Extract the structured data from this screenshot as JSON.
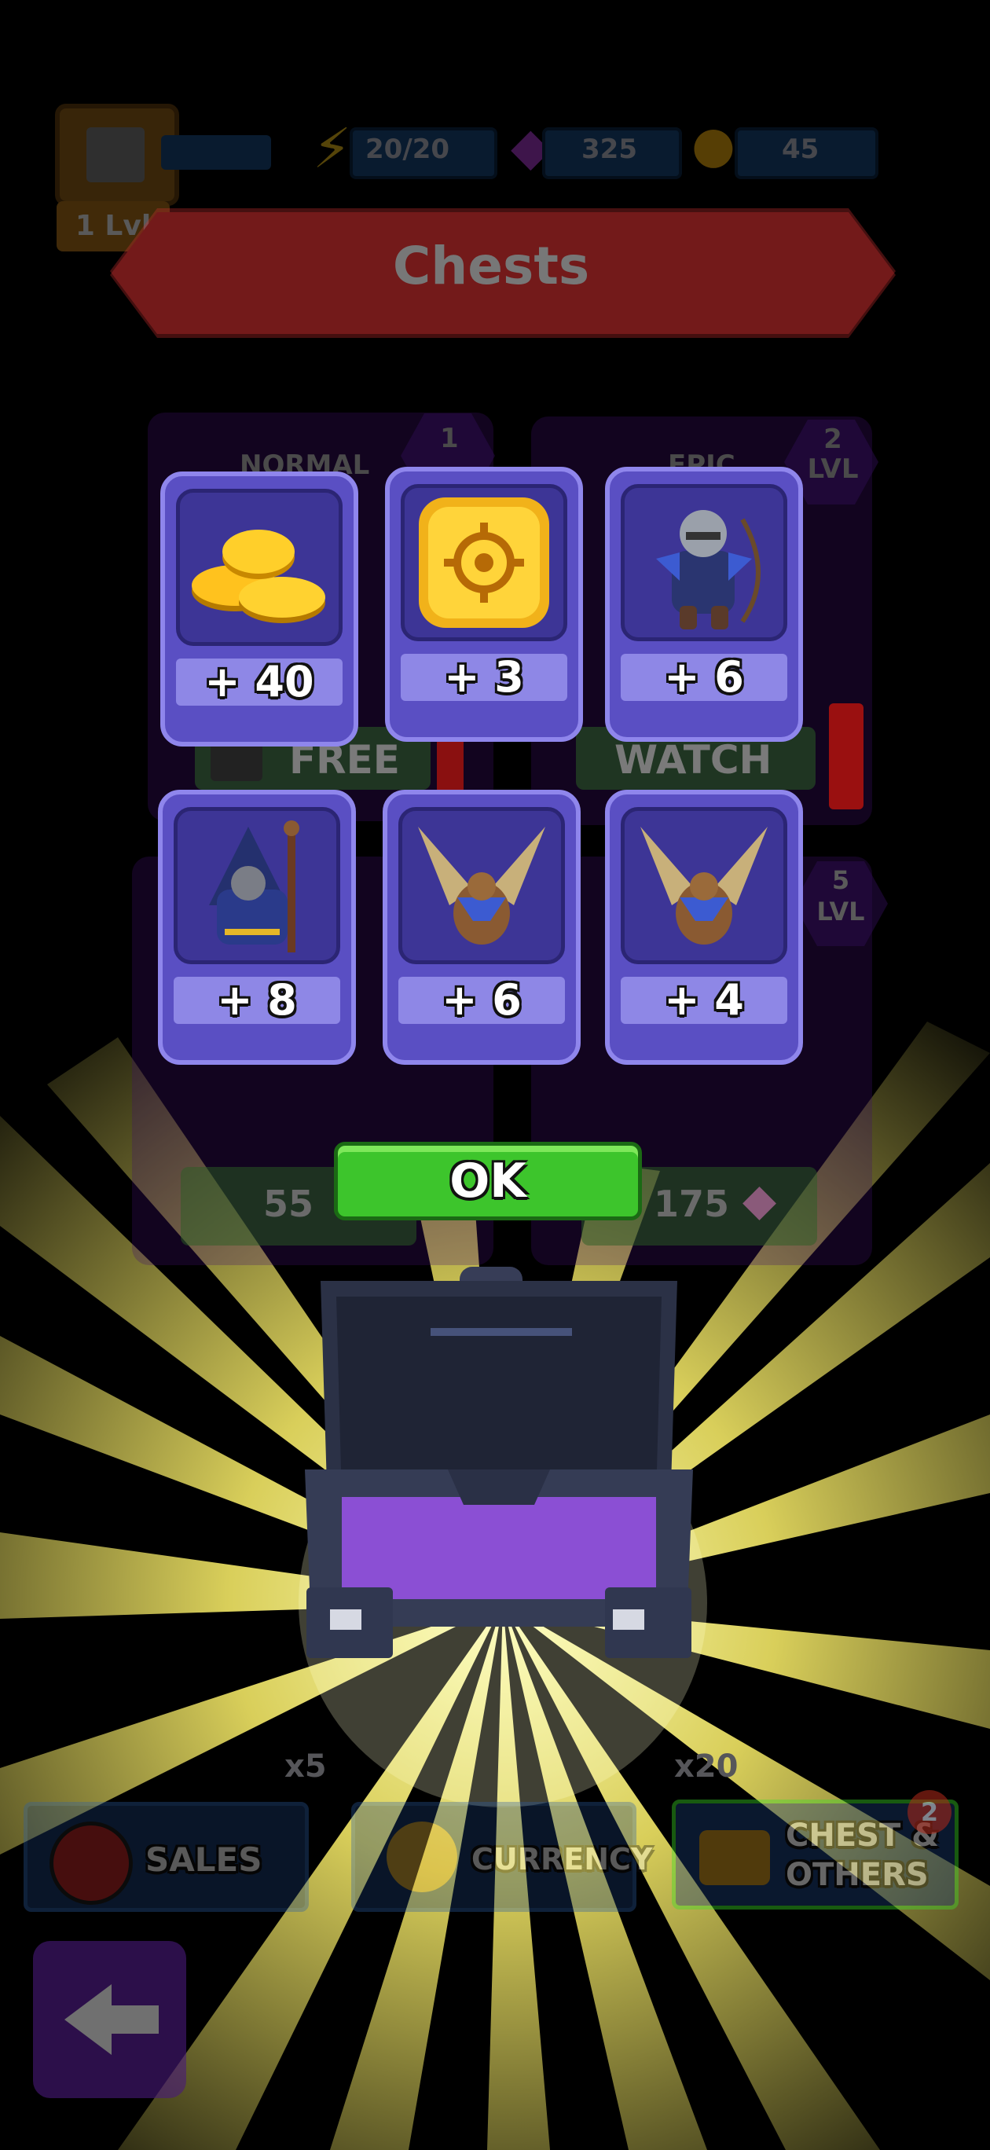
{
  "colors": {
    "accent": "#4fd13a",
    "tile": "#5a4fc3",
    "burst": "#fff36a",
    "panel": "#3f0f6e"
  },
  "header": {
    "level": "1 Lvl",
    "energy": "20/20",
    "gems": "325",
    "coins": "45",
    "title": "Chests"
  },
  "background": {
    "normal_label": "NORMAL",
    "normal_level": "1",
    "epic_label": "EPIC",
    "epic_level": "2 LVL",
    "free_button": "FREE",
    "watch_button": "WATCH",
    "lvl5": "5 LVL",
    "price_left": "55",
    "price_right": "175",
    "mult_left": "x5",
    "mult_right": "x20"
  },
  "rewards": [
    {
      "icon": "coins-icon",
      "amount": "+ 40"
    },
    {
      "icon": "gold-token-icon",
      "amount": "+ 3"
    },
    {
      "icon": "armored-archer-icon",
      "amount": "+ 6"
    },
    {
      "icon": "hooded-wizard-icon",
      "amount": "+ 8"
    },
    {
      "icon": "griffin-icon",
      "amount": "+ 6"
    },
    {
      "icon": "griffin-icon",
      "amount": "+ 4"
    }
  ],
  "ok_button": "OK",
  "tabs": {
    "sales": "SALES",
    "currency": "CURRENCY",
    "chests": "CHEST & OTHERS",
    "chests_badge": "2"
  }
}
